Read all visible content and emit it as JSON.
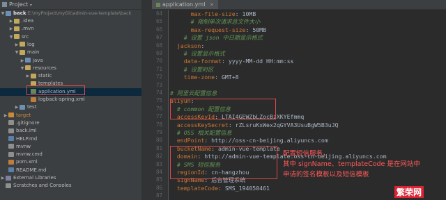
{
  "project_panel": {
    "title": "Project",
    "root": "back",
    "root_path": "E:\\myProject\\myGit\\admin-vue-template\\back",
    "items": [
      {
        "label": ".idea",
        "icon": "folder-icon"
      },
      {
        "label": ".mvn",
        "icon": "folder-icon"
      },
      {
        "label": "src",
        "icon": "folder-icon"
      },
      {
        "label": "log",
        "icon": "folder-icon"
      },
      {
        "label": "main",
        "icon": "folder-icon"
      },
      {
        "label": "java",
        "icon": "folder-icon"
      },
      {
        "label": "resources",
        "icon": "folder-icon"
      },
      {
        "label": "static",
        "icon": "folder-icon"
      },
      {
        "label": "templates",
        "icon": "folder-icon"
      },
      {
        "label": "application.yml",
        "icon": "yml-file-icon"
      },
      {
        "label": "logback-spring.xml",
        "icon": "xml-file-icon"
      },
      {
        "label": "test",
        "icon": "folder-icon"
      },
      {
        "label": "target",
        "icon": "folder-icon"
      },
      {
        "label": ".gitignore",
        "icon": "file-icon"
      },
      {
        "label": "back.iml",
        "icon": "file-icon"
      },
      {
        "label": "HELP.md",
        "icon": "md-file-icon"
      },
      {
        "label": "mvnw",
        "icon": "file-icon"
      },
      {
        "label": "mvnw.cmd",
        "icon": "file-icon"
      },
      {
        "label": "pom.xml",
        "icon": "xml-file-icon"
      },
      {
        "label": "README.md",
        "icon": "md-file-icon"
      },
      {
        "label": "External Libraries",
        "icon": "library-icon"
      },
      {
        "label": "Scratches and Consoles",
        "icon": "scratch-icon"
      }
    ]
  },
  "editor": {
    "tab_label": "application.yml",
    "line_numbers": [
      "64",
      "65",
      "66",
      "67",
      "68",
      "69",
      "70",
      "71",
      "72",
      "73",
      "74",
      "75",
      "76",
      "77",
      "78",
      "79",
      "80",
      "81",
      "82",
      "83",
      "84",
      "85",
      "86",
      "87"
    ],
    "lines": [
      {
        "indent": "      ",
        "key": "max-file-size",
        "value": "10MB",
        "comment": ""
      },
      {
        "indent": "      ",
        "key": "",
        "value": "",
        "comment": "# 限制单次请求总文件大小"
      },
      {
        "indent": "      ",
        "key": "max-request-size",
        "value": "50MB",
        "comment": ""
      },
      {
        "indent": "    ",
        "key": "",
        "value": "",
        "comment": "# 设置 json 中日期显示格式"
      },
      {
        "indent": "  ",
        "key": "jackson",
        "value": "",
        "comment": ""
      },
      {
        "indent": "    ",
        "key": "",
        "value": "",
        "comment": "# 设置显示格式"
      },
      {
        "indent": "    ",
        "key": "date-format",
        "value": "yyyy-MM-dd HH:mm:ss",
        "comment": ""
      },
      {
        "indent": "    ",
        "key": "",
        "value": "",
        "comment": "# 设置时区"
      },
      {
        "indent": "    ",
        "key": "time-zone",
        "value": "GMT+8",
        "comment": ""
      },
      {
        "indent": "",
        "key": "",
        "value": "",
        "comment": ""
      },
      {
        "indent": "",
        "key": "",
        "value": "",
        "comment": "# 阿里云配置信息"
      },
      {
        "indent": "",
        "key": "aliyun",
        "value": "",
        "comment": ""
      },
      {
        "indent": "  ",
        "key": "",
        "value": "",
        "comment": "# common 配置信息"
      },
      {
        "indent": "  ",
        "key": "accessKeyId",
        "value": "LTAI4GEWZbLZocBzXKYEfmmq",
        "comment": ""
      },
      {
        "indent": "  ",
        "key": "accessKeySecret",
        "value": "rZLsruKxWex2qGYVA3UsuBgW5B3uJQ",
        "comment": ""
      },
      {
        "indent": "  ",
        "key": "",
        "value": "",
        "comment": "# OSS 相关配置信息"
      },
      {
        "indent": "  ",
        "key": "endPoint",
        "value": "http://oss-cn-beijing.aliyuncs.com",
        "comment": ""
      },
      {
        "indent": "  ",
        "key": "bucketName",
        "value": "admin-vue-template",
        "comment": ""
      },
      {
        "indent": "  ",
        "key": "domain",
        "value": "http://admin-vue-template.oss-cn-beijing.aliyuncs.com",
        "comment": ""
      },
      {
        "indent": "  ",
        "key": "",
        "value": "",
        "comment": "# SMS 短信服务"
      },
      {
        "indent": "  ",
        "key": "regionId",
        "value": "cn-hangzhou",
        "comment": ""
      },
      {
        "indent": "  ",
        "key": "signName",
        "value": "后台管理系统",
        "comment": ""
      },
      {
        "indent": "  ",
        "key": "templateCode",
        "value": "SMS_194050461",
        "comment": ""
      },
      {
        "indent": "",
        "key": "",
        "value": "",
        "comment": ""
      }
    ]
  },
  "annotation": {
    "text": "配置短信服务，\n其中 signName、templateCode 是在网站中\n申请的签名模板以及短信模板"
  },
  "watermark": "繁荣网"
}
